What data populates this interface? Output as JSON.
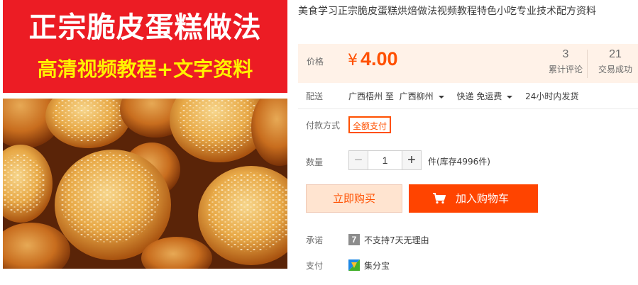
{
  "image": {
    "banner_line1": "正宗脆皮蛋糕做法",
    "banner_line2": "高清视频教程+文字资料"
  },
  "product": {
    "title": "美食学习正宗脆皮蛋糕烘焙做法视频教程特色小吃专业技术配方资料"
  },
  "price": {
    "label": "价格",
    "currency": "¥",
    "value": "4.00",
    "reviews_count": "3",
    "reviews_label": "累计评论",
    "deals_count": "21",
    "deals_label": "交易成功"
  },
  "shipping": {
    "label": "配送",
    "from": "广西梧州 至",
    "to": "广西柳州",
    "method": "快递 免运费",
    "dispatch": "24小时内发货"
  },
  "payment": {
    "label": "付款方式",
    "option": "全额支付"
  },
  "quantity": {
    "label": "数量",
    "minus": "−",
    "value": "1",
    "plus": "+",
    "stock": "件(库存4996件)"
  },
  "actions": {
    "buy_now": "立即购买",
    "add_to_cart": "加入购物车"
  },
  "promise": {
    "label": "承诺",
    "badge": "7",
    "text": "不支持7天无理由"
  },
  "pay": {
    "label": "支付",
    "text": "集分宝"
  },
  "colors": {
    "accent": "#ff5000",
    "cart_button": "#ff4400",
    "banner_red": "#ec1c24",
    "banner_yellow": "#fff200"
  }
}
